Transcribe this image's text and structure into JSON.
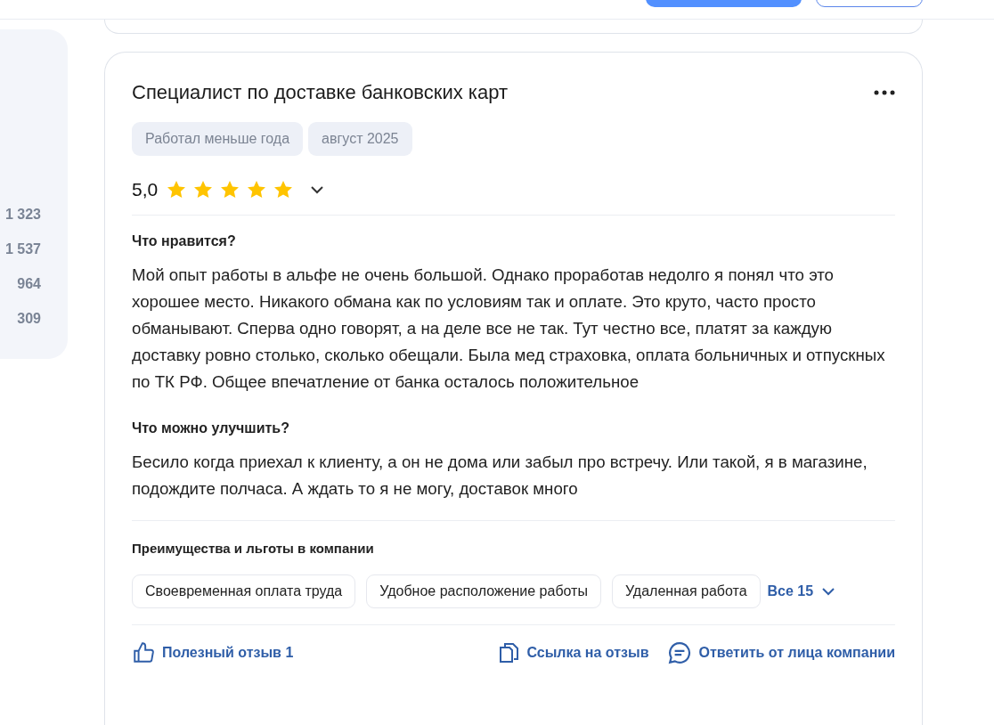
{
  "sidebar": {
    "counts": [
      "1 323",
      "1 537",
      "964",
      "309"
    ]
  },
  "review": {
    "title": "Специалист по доставке банковских карт",
    "tags": [
      "Работал меньше года",
      "август 2025"
    ],
    "rating": "5,0",
    "stars": 5,
    "sections": [
      {
        "heading": "Что нравится?",
        "text": "Мой опыт работы в альфе не очень большой. Однако проработав недолго я понял что это хорошее место. Никакого обмана как по условиям так и оплате. Это круто, часто просто обманывают. Сперва одно говорят, а на деле все не так. Тут честно все, платят за каждую доставку ровно столько, сколько обещали. Была мед страховка, оплата больничных и отпускных по ТК РФ. Общее впечатление от банка осталось положительное"
      },
      {
        "heading": "Что можно улучшить?",
        "text": "Бесило когда приехал к клиенту, а он не дома или забыл про встречу. Или такой, я в магазине, подождите полчаса. А ждать то я не могу, доставок много"
      }
    ],
    "benefits": {
      "heading": "Преимущества и льготы в компании",
      "items": [
        "Своевременная оплата труда",
        "Удобное расположение работы",
        "Удаленная работа"
      ],
      "more": "Все 15"
    },
    "actions": {
      "helpful": "Полезный отзыв 1",
      "link": "Ссылка на отзыв",
      "reply": "Ответить от лица компании"
    }
  }
}
